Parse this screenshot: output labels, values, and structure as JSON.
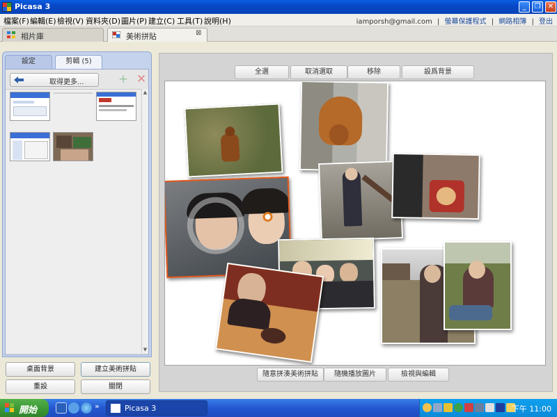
{
  "window": {
    "title": "Picasa 3"
  },
  "menu": {
    "items": [
      "檔案(F)",
      "編輯(E)",
      "檢視(V)",
      "資料夾(D)",
      "圖片(P)",
      "建立(C)",
      "工具(T)",
      "說明(H)"
    ],
    "account": "iamporsh@gmail.com",
    "sep": "|",
    "links": [
      "螢幕保護程式",
      "網路相簿",
      "登出"
    ]
  },
  "tabs": {
    "library": "相片庫",
    "collage": "美術拼貼"
  },
  "left_panel": {
    "tab_settings": "設定",
    "tab_clips": "剪輯 (5)",
    "get_more": "取得更多...",
    "buttons": {
      "desktop_bg": "桌面背景",
      "create_collage": "建立美術拼貼",
      "reset": "重設",
      "close": "關閉"
    }
  },
  "toolbar": {
    "select_all": "全選",
    "deselect": "取消選取",
    "remove": "移除",
    "set_background": "設爲背景"
  },
  "bottom_buttons": {
    "shuffle": "隨意拼湊美術拼貼",
    "random": "隨機播放圖片",
    "view_edit": "檢視與編輯"
  },
  "taskbar": {
    "start": "開始",
    "task": "Picasa 3",
    "clock": "下午 11:00"
  },
  "colors": {
    "titlebar": "#0848C8",
    "taskbar": "#2457D2",
    "start": "#3A9634",
    "panel": "#C6D3EC"
  }
}
